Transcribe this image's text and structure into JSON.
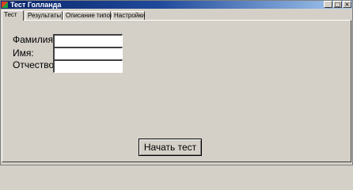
{
  "window": {
    "title": "Тест Голланда",
    "controls": {
      "minimize": "_",
      "maximize": "□",
      "close": "×"
    }
  },
  "tabs": [
    {
      "label": "Тест",
      "active": true
    },
    {
      "label": "Результаты",
      "active": false
    },
    {
      "label": "Описание типов",
      "active": false
    },
    {
      "label": "Настройки",
      "active": false
    }
  ],
  "form": {
    "last_name_label": "Фамилия:",
    "first_name_label": "Имя:",
    "patronymic_label": "Отчество:",
    "last_name_value": "",
    "first_name_value": "",
    "patronymic_value": ""
  },
  "start_button_label": "Начать тест",
  "colors": {
    "face": "#d4d0c8",
    "title_start": "#0a246a",
    "title_end": "#a6caf0"
  }
}
